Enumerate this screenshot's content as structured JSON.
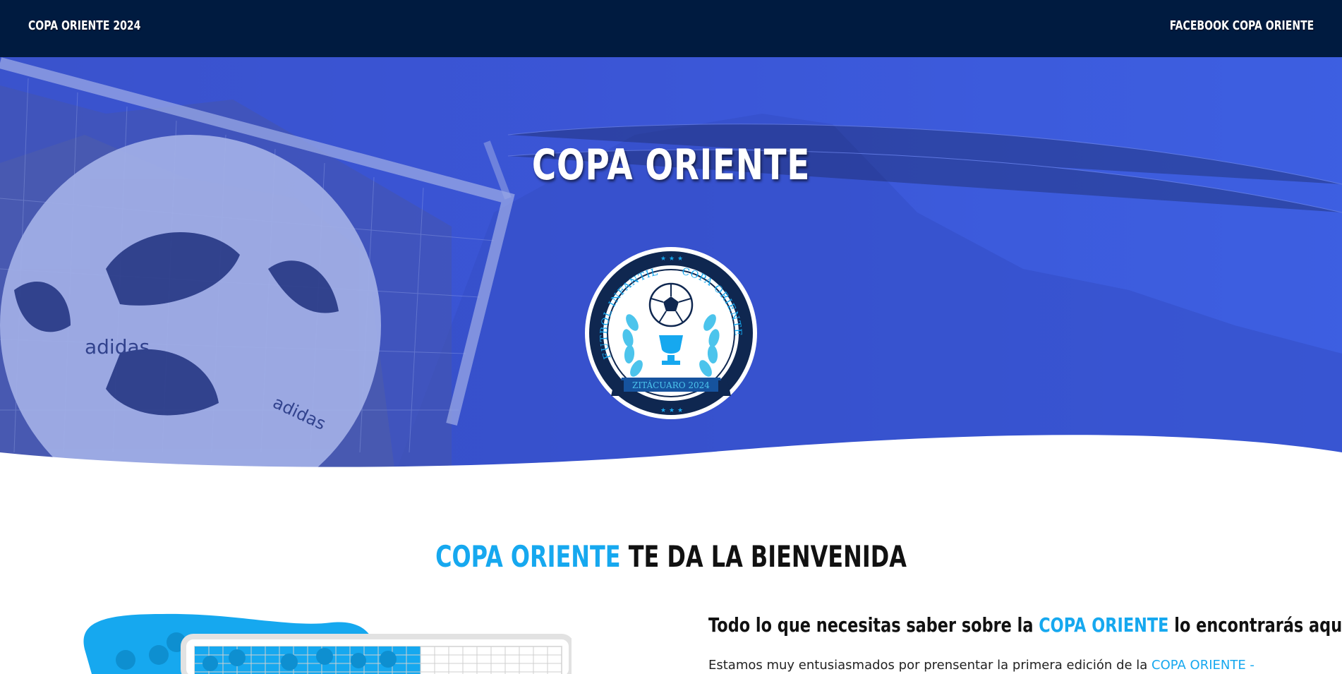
{
  "nav": {
    "brand": "COPA ORIENTE 2024",
    "facebook_link": "FACEBOOK COPA ORIENTE"
  },
  "hero": {
    "title": "COPA ORIENTE",
    "badge": {
      "top_left_text": "FUTBOL INFANTIL",
      "top_right_text": "COPA ORIENTE",
      "ribbon_text": "ZITÁCUARO 2024"
    },
    "ball_brand": "adidas"
  },
  "welcome": {
    "highlight": "COPA ORIENTE",
    "rest": "TE DA LA BIENVENIDA"
  },
  "info": {
    "heading_before": "Todo lo que necesitas saber sobre la ",
    "heading_highlight": "COPA ORIENTE",
    "heading_after": " lo encontrarás aquí:",
    "paragraph_before": "Estamos muy entusiasmados por prensentar la primera edición de la ",
    "paragraph_highlight": "COPA ORIENTE -"
  },
  "colors": {
    "navbar": "#001b40",
    "accent": "#16a8ef",
    "hero_blue": "#3a5ad6"
  }
}
